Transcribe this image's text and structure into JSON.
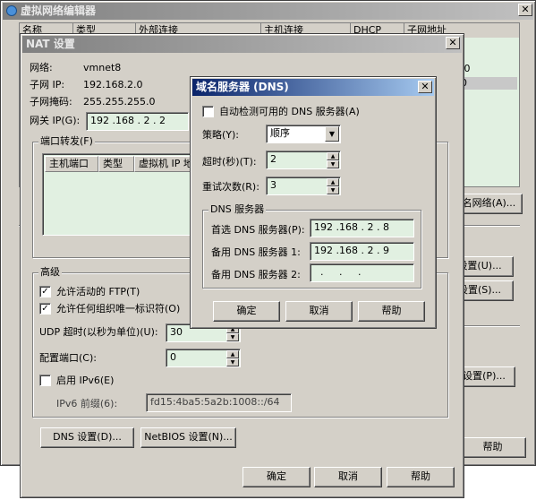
{
  "main_window": {
    "title": "虚拟网络编辑器",
    "header_fragments": [
      "名称",
      "类型",
      "外部连接",
      "主机连接",
      "DHCP",
      "子网地址"
    ],
    "visible_cells": [
      ".0",
      "0"
    ],
    "buttons": {
      "add_network_fragment": "名网络(A)...",
      "dhcp_settings_fragment": "设置(U)...",
      "nat_settings_fragment": "设置(S)...",
      "more_settings_fragment": "设置(P)...",
      "help": "帮助"
    }
  },
  "nat_dialog": {
    "title": "NAT 设置",
    "network_label": "网络:",
    "network_value": "vmnet8",
    "subnet_ip_label": "子网 IP:",
    "subnet_ip_value": "192.168.2.0",
    "subnet_mask_label": "子网掩码:",
    "subnet_mask_value": "255.255.255.0",
    "gateway_label": "网关 IP(G):",
    "gateway_value": "192 .168 . 2  . 2",
    "port_forward_group": "端口转发(F)",
    "port_forward_columns": [
      "主机端口",
      "类型",
      "虚拟机 IP 地址"
    ],
    "advanced_group": "高级",
    "allow_ftp_label": "允许活动的 FTP(T)",
    "allow_ftp_checked": true,
    "allow_oui_label": "允许任何组织唯一标识符(O)",
    "allow_oui_checked": true,
    "udp_timeout_label": "UDP 超时(以秒为单位)(U):",
    "udp_timeout_value": "30",
    "config_port_label": "配置端口(C):",
    "config_port_value": "0",
    "enable_ipv6_label": "启用 IPv6(E)",
    "enable_ipv6_checked": false,
    "ipv6_prefix_label": "IPv6 前缀(6):",
    "ipv6_prefix_value": "fd15:4ba5:5a2b:1008::/64",
    "dns_settings_button": "DNS 设置(D)...",
    "netbios_settings_button": "NetBIOS 设置(N)...",
    "ok_button": "确定",
    "cancel_button": "取消",
    "help_button": "帮助"
  },
  "dns_dialog": {
    "title": "域名服务器 (DNS)",
    "auto_detect_label": "自动检测可用的 DNS 服务器(A)",
    "auto_detect_checked": false,
    "policy_label": "策略(Y):",
    "policy_value": "顺序",
    "timeout_label": "超时(秒)(T):",
    "timeout_value": "2",
    "retries_label": "重试次数(R):",
    "retries_value": "3",
    "servers_group": "DNS 服务器",
    "preferred_label": "首选 DNS 服务器(P):",
    "preferred_value": "192 .168 . 2  . 8",
    "alternate1_label": "备用 DNS 服务器 1:",
    "alternate1_value": "192 .168 . 2  . 9",
    "alternate2_label": "备用 DNS 服务器 2:",
    "alternate2_value": "  .     .     .",
    "ok_button": "确定",
    "cancel_button": "取消",
    "help_button": "帮助"
  },
  "colors": {
    "dialog_face": "#d4d0c8",
    "field_background": "#e1f0e1",
    "active_title": "#0a246a",
    "inactive_title": "#808080"
  }
}
